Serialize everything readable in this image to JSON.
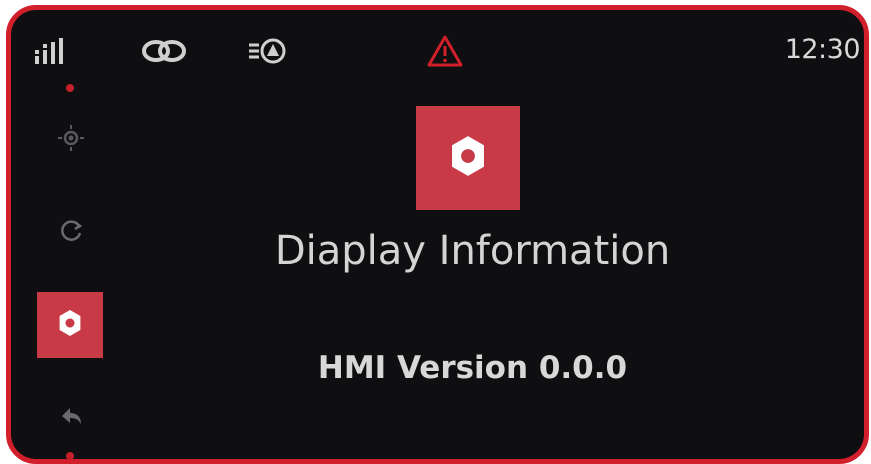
{
  "status_bar": {
    "icons": [
      "signal-strength-icon",
      "link-icon",
      "headlight-icon",
      "warning-icon"
    ],
    "clock": "12:30"
  },
  "sidebar": {
    "items": [
      {
        "icon": "brightness-icon",
        "active": false
      },
      {
        "icon": "refresh-icon",
        "active": false
      },
      {
        "icon": "gear-icon",
        "active": true
      },
      {
        "icon": "back-icon",
        "active": false
      }
    ]
  },
  "main": {
    "icon": "gear-icon",
    "title": "Diaplay Information",
    "version_text": "HMI Version 0.0.0"
  },
  "colors": {
    "accent": "#c83a46",
    "frame_border": "#d11f2b",
    "background": "#0f0f11",
    "warning": "#d11f2b",
    "text": "#d4d4d4"
  }
}
